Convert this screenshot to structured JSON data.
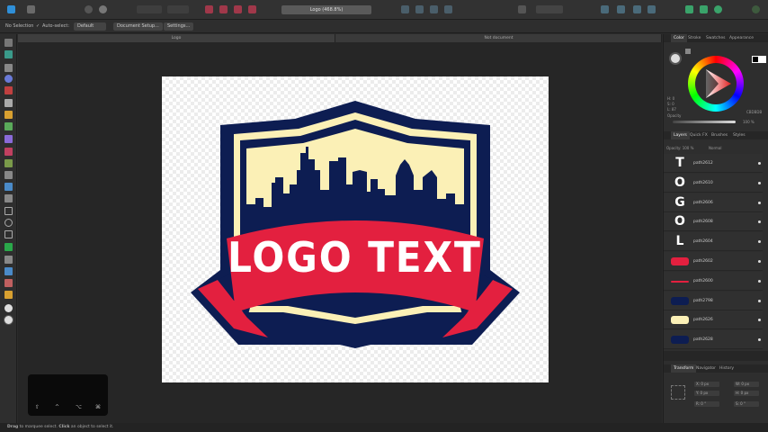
{
  "toolbar": {
    "doc_title": "Logo (468.8%)"
  },
  "context": {
    "selection": "No Selection",
    "auto_select_label": "Auto-select:",
    "auto_select_value": "Default",
    "document_setup": "Document Setup...",
    "settings": "Settings..."
  },
  "tabs": [
    {
      "label": "Logo"
    },
    {
      "label": "Not document"
    }
  ],
  "overlay": {
    "keys": [
      "⇧",
      "^",
      "⌥",
      "⌘"
    ]
  },
  "status": {
    "prefix": "Drag",
    "text1": " to marquee select. ",
    "click": "Click",
    "text2": " an object to select it."
  },
  "logo": {
    "text": "LOGO TEXT"
  },
  "color_panel": {
    "tabs": [
      "Color",
      "Stroke",
      "Swatches",
      "Appearance"
    ],
    "hex": "CBDBDB",
    "h": "H: 0",
    "s": "S: 0",
    "l": "L: 87",
    "opacity_label": "Opacity",
    "opacity_value": "100 %"
  },
  "layers_panel": {
    "tabs": [
      "Layers",
      "Quick FX",
      "Brushes",
      "Styles"
    ],
    "opacity": "Opacity: 100 %",
    "blend": "Normal",
    "items": [
      {
        "name": "path2612"
      },
      {
        "name": "path2610"
      },
      {
        "name": "path2606"
      },
      {
        "name": "path2608"
      },
      {
        "name": "path2604"
      },
      {
        "name": "path2602"
      },
      {
        "name": "path2600"
      },
      {
        "name": "path2798"
      },
      {
        "name": "path2626"
      },
      {
        "name": "path2628"
      }
    ]
  },
  "transform_panel": {
    "tabs": [
      "Transform",
      "Navigator",
      "History"
    ],
    "x": "X: 0 px",
    "y": "Y: 0 px",
    "w": "W: 0 px",
    "h": "H: 0 px",
    "r": "R: 0 °",
    "s": "S: 0 °"
  },
  "colors": {
    "navy": "#0d1d52",
    "red": "#e3203f",
    "cream": "#fbf0b6"
  }
}
